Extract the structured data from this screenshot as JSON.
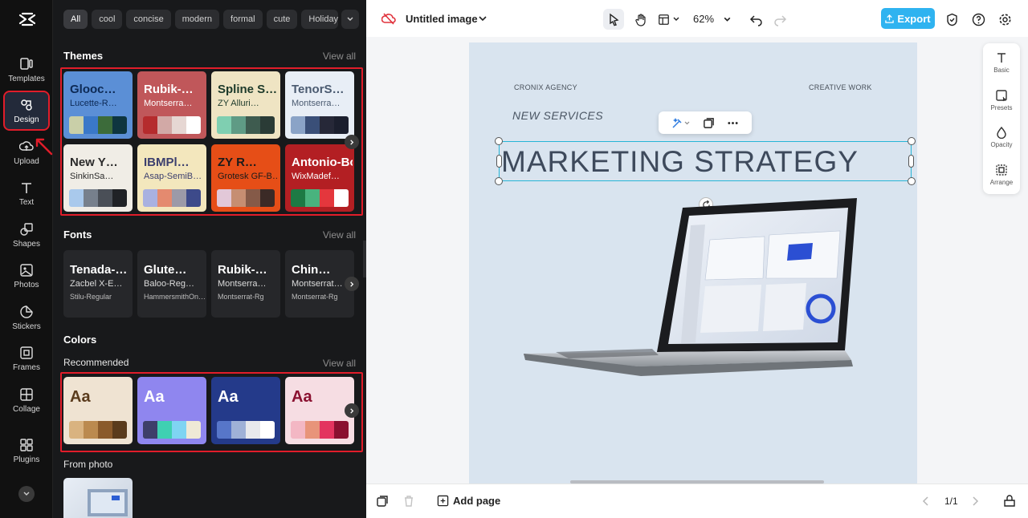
{
  "rail": {
    "items": [
      {
        "label": "Templates",
        "icon": "templates-icon"
      },
      {
        "label": "Design",
        "icon": "design-icon"
      },
      {
        "label": "Upload",
        "icon": "upload-icon"
      },
      {
        "label": "Text",
        "icon": "text-icon"
      },
      {
        "label": "Shapes",
        "icon": "shapes-icon"
      },
      {
        "label": "Photos",
        "icon": "photos-icon"
      },
      {
        "label": "Stickers",
        "icon": "stickers-icon"
      },
      {
        "label": "Frames",
        "icon": "frames-icon"
      },
      {
        "label": "Collage",
        "icon": "collage-icon"
      },
      {
        "label": "Plugins",
        "icon": "plugins-icon"
      }
    ],
    "active": "Design"
  },
  "panel": {
    "chips": [
      "All",
      "cool",
      "concise",
      "modern",
      "formal",
      "cute",
      "Holiday"
    ],
    "themes": {
      "title": "Themes",
      "view_all": "View all",
      "cards": [
        {
          "t1": "Glooc…",
          "t2": "Lucette-R…",
          "bg": "#5b8fd6",
          "fg": "#0d2a55",
          "swatches": [
            "#c9cfa8",
            "#3a78c8",
            "#3c6b3a",
            "#0e3540"
          ]
        },
        {
          "t1": "Rubik-…",
          "t2": "Montserra…",
          "bg": "#c0575a",
          "fg": "#ffffff",
          "swatches": [
            "#b52b2d",
            "#d2a9a6",
            "#e6d7d3",
            "#ffffff"
          ]
        },
        {
          "t1": "Spline S…",
          "t2": "ZY Alluri…",
          "bg": "#efe4c3",
          "fg": "#1d3a2a",
          "swatches": [
            "#7fcfb1",
            "#5f9b85",
            "#3e5b4f",
            "#2a3b36"
          ]
        },
        {
          "t1": "TenorS…",
          "t2": "Montserra…",
          "bg": "#e8eef6",
          "fg": "#4a5a70",
          "swatches": [
            "#8aa3c7",
            "#3a4f78",
            "#262838",
            "#1b1f2e"
          ]
        },
        {
          "t1": "New Y…",
          "t2": "SinkinSa…",
          "bg": "#f0ede6",
          "fg": "#2b2b2b",
          "swatches": [
            "#a9c9ec",
            "#77808c",
            "#4a4f57",
            "#202226"
          ]
        },
        {
          "t1": "IBMPl…",
          "t2": "Asap-SemiB…",
          "bg": "#f3e7bd",
          "fg": "#3c3f6e",
          "swatches": [
            "#a9b1e0",
            "#e48a6f",
            "#9c9aa8",
            "#3d4a8a"
          ]
        },
        {
          "t1": "ZY R…",
          "t2": "Grotesk GF-B…",
          "bg": "#e64e17",
          "fg": "#1b1b1b",
          "swatches": [
            "#e2c8d8",
            "#c68e72",
            "#855a48",
            "#3b2a26"
          ]
        },
        {
          "t1": "Antonio-Bold",
          "t2": "WixMadef…",
          "bg": "#b31f23",
          "fg": "#ffffff",
          "swatches": [
            "#1d7a44",
            "#49b37e",
            "#e4373d",
            "#ffffff"
          ]
        }
      ]
    },
    "fonts": {
      "title": "Fonts",
      "view_all": "View all",
      "cards": [
        {
          "f1": "Tenada-…",
          "f2": "Zacbel X-E…",
          "f3": "Stilu-Regular"
        },
        {
          "f1": "Glute…",
          "f2": "Baloo-Reg…",
          "f3": "HammersmithOn…"
        },
        {
          "f1": "Rubik-…",
          "f2": "Montserra…",
          "f3": "Montserrat-Rg"
        },
        {
          "f1": "Chin…",
          "f2": "Montserrat…",
          "f3": "Montserrat-Rg"
        }
      ]
    },
    "colors": {
      "title": "Colors",
      "recommended": "Recommended",
      "view_all": "View all",
      "cards": [
        {
          "label": "Aa",
          "bg": "#efe3d2",
          "fg": "#5a3b1c",
          "swatches": [
            "#d9b380",
            "#bb8a4f",
            "#8a5a2b",
            "#5a3b1c"
          ]
        },
        {
          "label": "Aa",
          "bg": "#8f86ef",
          "fg": "#ffffff",
          "swatches": [
            "#3e3f6a",
            "#3fd0b2",
            "#7fd4f2",
            "#efe9d6"
          ]
        },
        {
          "label": "Aa",
          "bg": "#243a8a",
          "fg": "#ffffff",
          "swatches": [
            "#5776c9",
            "#9fb1d7",
            "#e8e9ec",
            "#ffffff"
          ]
        },
        {
          "label": "Aa",
          "bg": "#f6dde3",
          "fg": "#8a1030",
          "swatches": [
            "#f3b7c4",
            "#e8947a",
            "#e3345f",
            "#8a1030"
          ]
        }
      ]
    },
    "from_photo": "From photo"
  },
  "topbar": {
    "title": "Untitled image",
    "zoom": "62%",
    "export": "Export"
  },
  "canvas": {
    "agency": "CRONIX AGENCY",
    "creative": "CREATIVE WORK",
    "new_services": "NEW SERVICES",
    "headline": "MARKETING STRATEGY"
  },
  "right_panel": {
    "items": [
      "Basic",
      "Presets",
      "Opacity",
      "Arrange"
    ]
  },
  "bottombar": {
    "add_page": "Add page",
    "page_indicator": "1/1"
  },
  "accent": "#2fb3f0",
  "highlight_color": "#e11d2a"
}
